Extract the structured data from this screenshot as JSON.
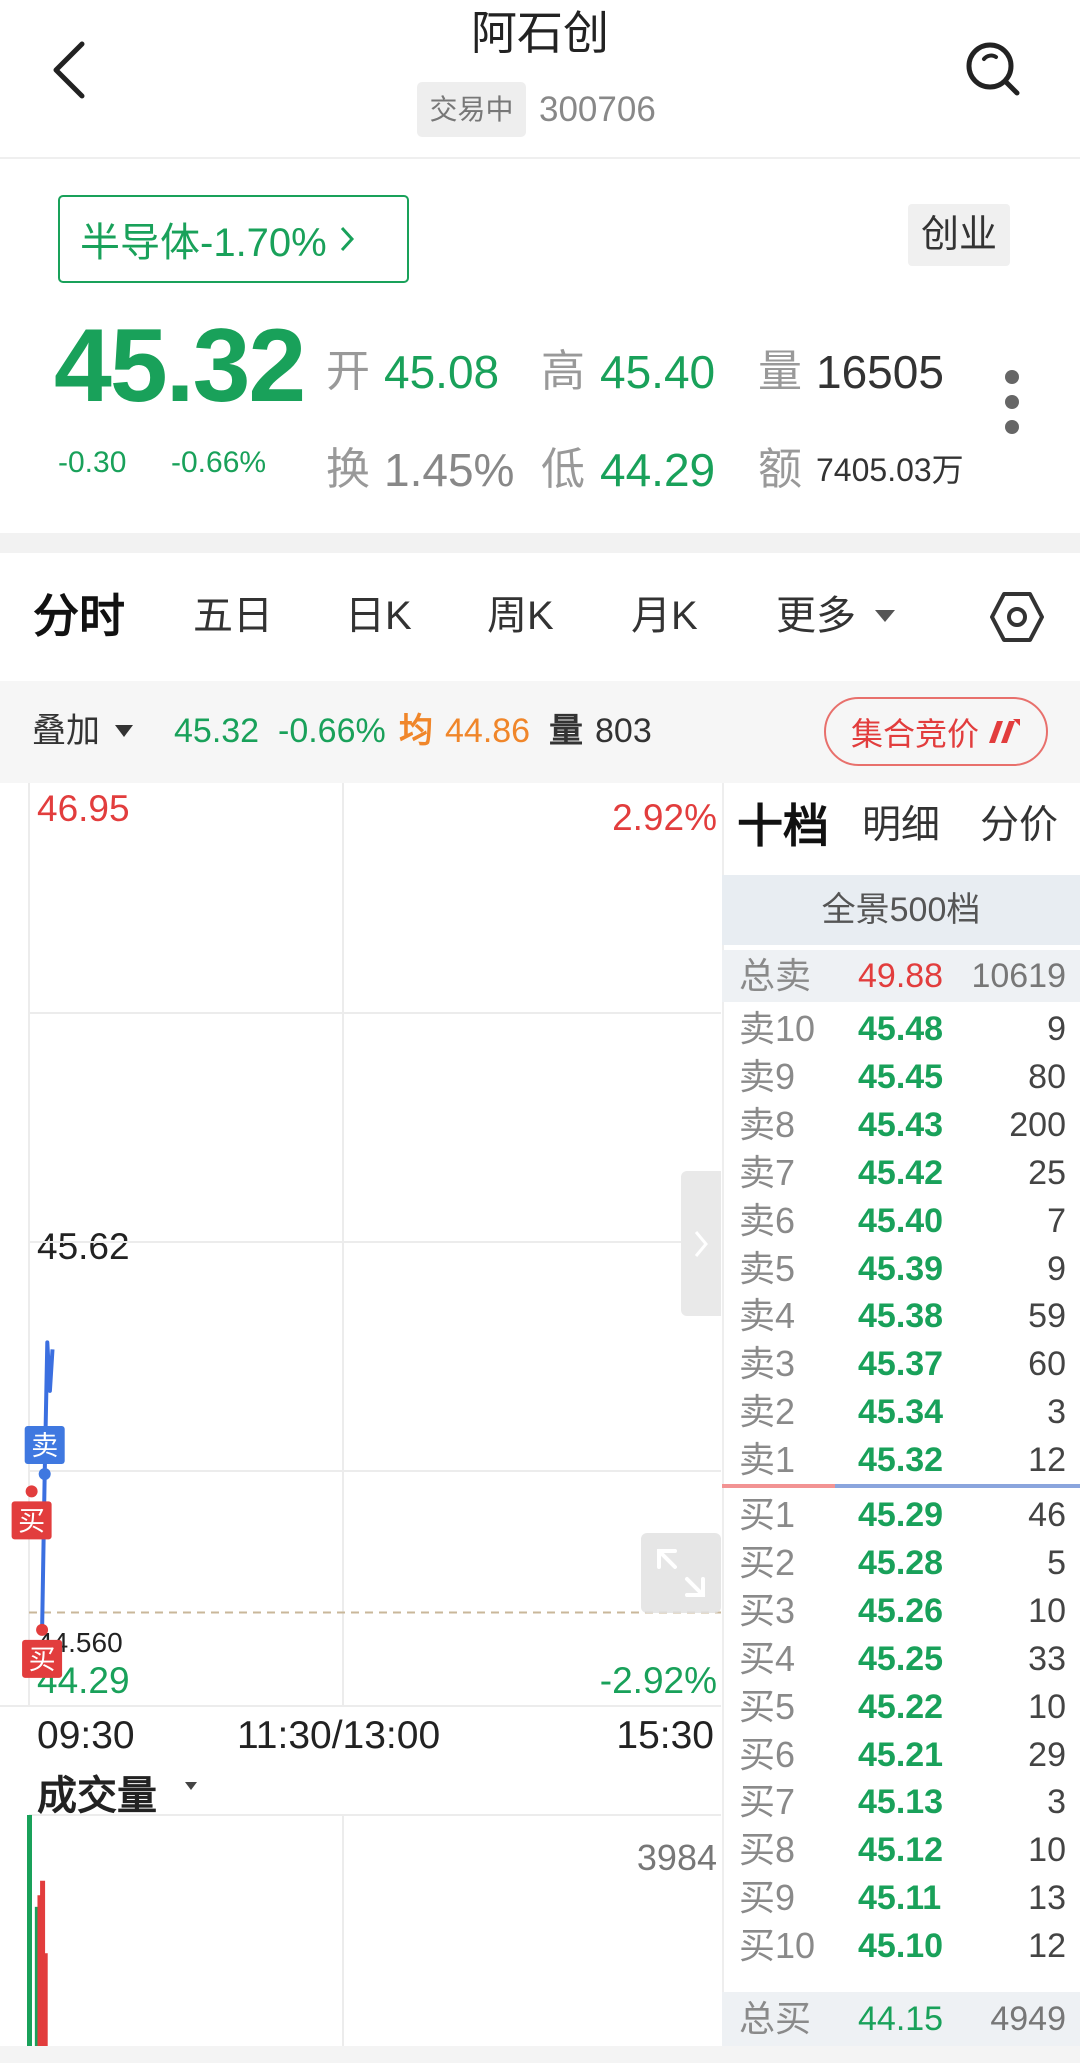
{
  "header": {
    "title": "阿石创",
    "status_badge": "交易中",
    "stock_code": "300706"
  },
  "quote": {
    "sector_label": "半导体-1.70%",
    "board": "创业",
    "price": "45.32",
    "change": "-0.30",
    "change_pct": "-0.66%",
    "stats": {
      "open": {
        "label": "开",
        "value": "45.08"
      },
      "high": {
        "label": "高",
        "value": "45.40"
      },
      "volume": {
        "label": "量",
        "value": "16505"
      },
      "turnover": {
        "label": "换",
        "value": "1.45%"
      },
      "low": {
        "label": "低",
        "value": "44.29"
      },
      "amount": {
        "label": "额",
        "value": "7405.03万"
      }
    }
  },
  "tabs": {
    "intraday": "分时",
    "five_day": "五日",
    "daily_k": "日K",
    "weekly_k": "周K",
    "monthly_k": "月K",
    "more": "更多"
  },
  "info_bar": {
    "overlay": "叠加",
    "price": "45.32",
    "change_pct": "-0.66%",
    "avg_label": "均",
    "avg_value": "44.86",
    "vol_label": "量",
    "vol_value": "803",
    "auction_button": "集合竞价"
  },
  "chart_data": {
    "type": "line",
    "ylim": [
      44.29,
      46.95
    ],
    "y_labels": {
      "top": "46.95",
      "middle": "45.62",
      "bottom": "44.29",
      "top_pct": "2.92%",
      "bottom_pct": "-2.92%"
    },
    "x_ticks": [
      "09:30",
      "11:30/13:00",
      "15:30"
    ],
    "reference_line": {
      "label": "44.560",
      "value": 44.56
    },
    "series": [
      {
        "x": [
          "09:35",
          "09:36",
          "09:37",
          "09:38",
          "09:39"
        ],
        "values": [
          44.51,
          44.96,
          45.34,
          45.2,
          45.32
        ]
      }
    ],
    "markers": [
      {
        "text": "卖",
        "side": "sell",
        "x": "09:36",
        "value": 44.96
      },
      {
        "text": "买",
        "side": "buy",
        "x": "09:31",
        "value": 44.91
      },
      {
        "text": "买",
        "side": "buy",
        "x": "09:35",
        "value": 44.51
      }
    ],
    "volume": {
      "title": "成交量",
      "max_label": "3984",
      "ymax": 3984,
      "x": [
        "09:30",
        "09:33",
        "09:34",
        "09:35",
        "09:36"
      ],
      "values": [
        3984,
        2400,
        2600,
        2850,
        1600
      ],
      "direction": [
        "down",
        "down",
        "up",
        "up",
        "up"
      ]
    }
  },
  "order_book": {
    "tabs": {
      "ten_levels": "十档",
      "details": "明细",
      "price_dist": "分价"
    },
    "panorama": "全景500档",
    "total_sell": {
      "label": "总卖",
      "price": "49.88",
      "volume": "10619"
    },
    "asks": [
      {
        "label": "卖10",
        "price": "45.48",
        "volume": "9"
      },
      {
        "label": "卖9",
        "price": "45.45",
        "volume": "80"
      },
      {
        "label": "卖8",
        "price": "45.43",
        "volume": "200"
      },
      {
        "label": "卖7",
        "price": "45.42",
        "volume": "25"
      },
      {
        "label": "卖6",
        "price": "45.40",
        "volume": "7"
      },
      {
        "label": "卖5",
        "price": "45.39",
        "volume": "9"
      },
      {
        "label": "卖4",
        "price": "45.38",
        "volume": "59"
      },
      {
        "label": "卖3",
        "price": "45.37",
        "volume": "60"
      },
      {
        "label": "卖2",
        "price": "45.34",
        "volume": "3"
      },
      {
        "label": "卖1",
        "price": "45.32",
        "volume": "12"
      }
    ],
    "bids": [
      {
        "label": "买1",
        "price": "45.29",
        "volume": "46"
      },
      {
        "label": "买2",
        "price": "45.28",
        "volume": "5"
      },
      {
        "label": "买3",
        "price": "45.26",
        "volume": "10"
      },
      {
        "label": "买4",
        "price": "45.25",
        "volume": "33"
      },
      {
        "label": "买5",
        "price": "45.22",
        "volume": "10"
      },
      {
        "label": "买6",
        "price": "45.21",
        "volume": "29"
      },
      {
        "label": "买7",
        "price": "45.13",
        "volume": "3"
      },
      {
        "label": "买8",
        "price": "45.12",
        "volume": "10"
      },
      {
        "label": "买9",
        "price": "45.11",
        "volume": "13"
      },
      {
        "label": "买10",
        "price": "45.10",
        "volume": "12"
      }
    ],
    "total_buy": {
      "label": "总买",
      "price": "44.15",
      "volume": "4949"
    }
  },
  "colors": {
    "up": "#e23d3d",
    "down": "#19a15a",
    "avg": "#f0862a",
    "price_line": "#3b6fe0",
    "sell_marker": "#3f78e0",
    "buy_marker": "#e23d3d"
  },
  "icons": {
    "back": "back-arrow-icon",
    "search": "search-icon",
    "sector": "chevron-right-icon",
    "more_menu": "more-vertical-icon",
    "settings": "hexagon-settings-icon",
    "dropdown": "caret-down-icon",
    "auction": "auction-icon",
    "panel_toggle": "chevron-right-icon",
    "fullscreen": "expand-icon"
  }
}
